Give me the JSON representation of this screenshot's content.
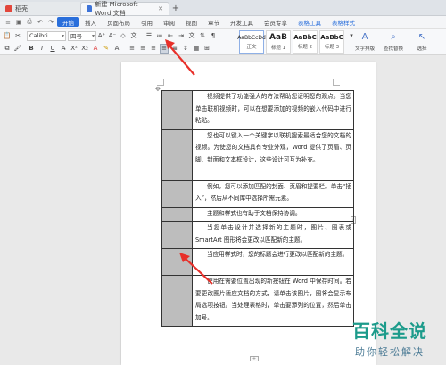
{
  "titlebar": {
    "home_tab": "稻壳",
    "doc_tab": "新建 Microsoft Word 文档"
  },
  "menubar": {
    "items": [
      "开始",
      "插入",
      "页面布局",
      "引用",
      "审阅",
      "视图",
      "章节",
      "开发工具",
      "会员专享",
      "表格工具",
      "表格样式"
    ]
  },
  "toolbar": {
    "font_name": "Calibri",
    "font_size": "四号",
    "styles": [
      {
        "preview": "AaBbCcDd",
        "name": "正文"
      },
      {
        "preview": "AaB",
        "name": "标题 1"
      },
      {
        "preview": "AaBbC",
        "name": "标题 2"
      },
      {
        "preview": "AaBbC",
        "name": "标题 3"
      }
    ],
    "text_tool": "文字排版",
    "find_tool": "查找替换",
    "select_tool": "选择"
  },
  "document": {
    "rows": [
      {
        "text": "视频提供了功能强大的方法帮助您证明您的观点。当您单击联机视频时，可以在想要添加的视频的嵌入代码中进行粘贴。",
        "lines": 3
      },
      {
        "text": "您也可以键入一个关键字以联机搜索最适合您的文档的视频。为使您的文档具有专业外观，Word 提供了页眉、页脚、封面和文本框设计，这些设计可互为补充。",
        "lines": 4
      },
      {
        "text": "例如，您可以添加匹配的封面、页眉和提要栏。单击“插入”，然后从不同库中选择所需元素。",
        "lines": 2
      },
      {
        "text": "主题和样式也有助于文档保持协调。",
        "lines": 1
      },
      {
        "text": "当您单击设计并选择新的主题时，图片、图表或SmartArt 图形将会更改以匹配新的主题。",
        "lines": 2
      },
      {
        "text": "当应用样式时，您的标题会进行更改以匹配新的主题。",
        "lines": 2
      },
      {
        "text": "使用在需要位置出现的新按钮在 Word 中保存时间。若要更改图片适应文档的方式，请单击该图片，图将会显示布局选项按钮。当处理表格时，单击要添列的位置，然后单击加号。",
        "lines": 4
      }
    ]
  },
  "watermark": {
    "main": "百科全说",
    "sub": "助你轻松解决"
  },
  "colors": {
    "accent": "#2a6fdb",
    "arrow": "#e8302a",
    "cell_gray": "#bdbdbd",
    "watermark": "#1c9b8b"
  }
}
